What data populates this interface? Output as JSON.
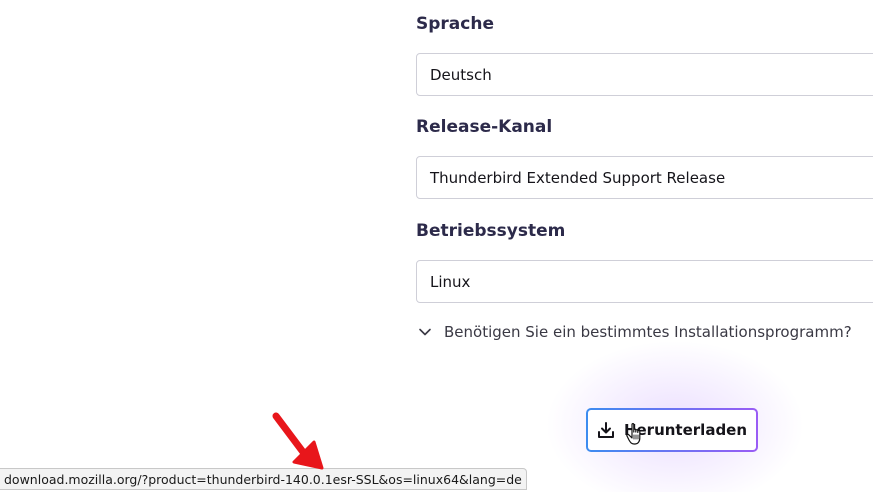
{
  "form": {
    "language": {
      "label": "Sprache",
      "value": "Deutsch"
    },
    "channel": {
      "label": "Release-Kanal",
      "value": "Thunderbird Extended Support Release"
    },
    "os": {
      "label": "Betriebssystem",
      "value": "Linux"
    },
    "installer_toggle": {
      "icon": "chevron-down-icon",
      "label": "Benötigen Sie ein bestimmtes Installationsprogramm?"
    },
    "download_button": {
      "icon": "download-icon",
      "label": "Herunterladen"
    }
  },
  "status_bar": {
    "url": "download.mozilla.org/?product=thunderbird-140.0.1esr-SSL&os=linux64&lang=de"
  },
  "colors": {
    "label_text": "#2c2a4a",
    "button_gradient_start": "#3c8cf0",
    "button_gradient_end": "#9a5cf5",
    "annotation_arrow": "#e8161b"
  }
}
